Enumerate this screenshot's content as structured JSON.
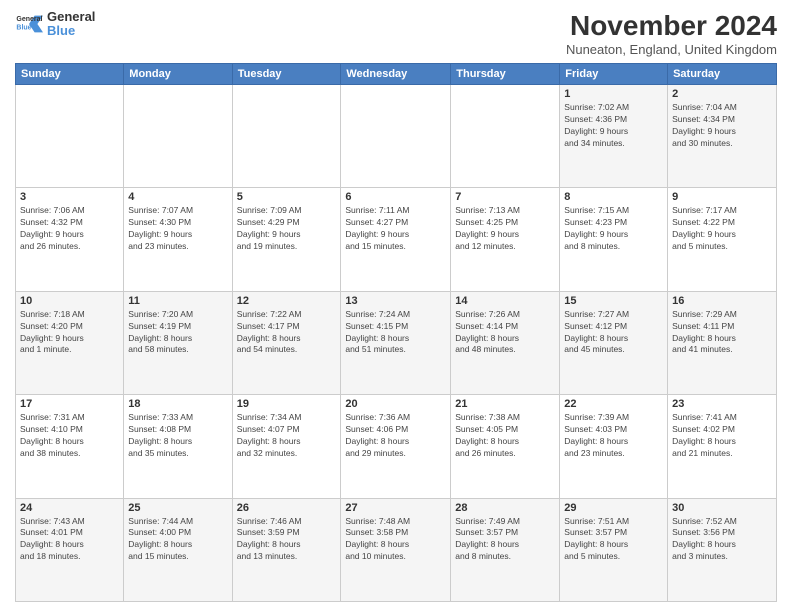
{
  "header": {
    "logo_general": "General",
    "logo_blue": "Blue",
    "month_year": "November 2024",
    "location": "Nuneaton, England, United Kingdom"
  },
  "weekdays": [
    "Sunday",
    "Monday",
    "Tuesday",
    "Wednesday",
    "Thursday",
    "Friday",
    "Saturday"
  ],
  "weeks": [
    [
      {
        "day": "",
        "info": ""
      },
      {
        "day": "",
        "info": ""
      },
      {
        "day": "",
        "info": ""
      },
      {
        "day": "",
        "info": ""
      },
      {
        "day": "",
        "info": ""
      },
      {
        "day": "1",
        "info": "Sunrise: 7:02 AM\nSunset: 4:36 PM\nDaylight: 9 hours\nand 34 minutes."
      },
      {
        "day": "2",
        "info": "Sunrise: 7:04 AM\nSunset: 4:34 PM\nDaylight: 9 hours\nand 30 minutes."
      }
    ],
    [
      {
        "day": "3",
        "info": "Sunrise: 7:06 AM\nSunset: 4:32 PM\nDaylight: 9 hours\nand 26 minutes."
      },
      {
        "day": "4",
        "info": "Sunrise: 7:07 AM\nSunset: 4:30 PM\nDaylight: 9 hours\nand 23 minutes."
      },
      {
        "day": "5",
        "info": "Sunrise: 7:09 AM\nSunset: 4:29 PM\nDaylight: 9 hours\nand 19 minutes."
      },
      {
        "day": "6",
        "info": "Sunrise: 7:11 AM\nSunset: 4:27 PM\nDaylight: 9 hours\nand 15 minutes."
      },
      {
        "day": "7",
        "info": "Sunrise: 7:13 AM\nSunset: 4:25 PM\nDaylight: 9 hours\nand 12 minutes."
      },
      {
        "day": "8",
        "info": "Sunrise: 7:15 AM\nSunset: 4:23 PM\nDaylight: 9 hours\nand 8 minutes."
      },
      {
        "day": "9",
        "info": "Sunrise: 7:17 AM\nSunset: 4:22 PM\nDaylight: 9 hours\nand 5 minutes."
      }
    ],
    [
      {
        "day": "10",
        "info": "Sunrise: 7:18 AM\nSunset: 4:20 PM\nDaylight: 9 hours\nand 1 minute."
      },
      {
        "day": "11",
        "info": "Sunrise: 7:20 AM\nSunset: 4:19 PM\nDaylight: 8 hours\nand 58 minutes."
      },
      {
        "day": "12",
        "info": "Sunrise: 7:22 AM\nSunset: 4:17 PM\nDaylight: 8 hours\nand 54 minutes."
      },
      {
        "day": "13",
        "info": "Sunrise: 7:24 AM\nSunset: 4:15 PM\nDaylight: 8 hours\nand 51 minutes."
      },
      {
        "day": "14",
        "info": "Sunrise: 7:26 AM\nSunset: 4:14 PM\nDaylight: 8 hours\nand 48 minutes."
      },
      {
        "day": "15",
        "info": "Sunrise: 7:27 AM\nSunset: 4:12 PM\nDaylight: 8 hours\nand 45 minutes."
      },
      {
        "day": "16",
        "info": "Sunrise: 7:29 AM\nSunset: 4:11 PM\nDaylight: 8 hours\nand 41 minutes."
      }
    ],
    [
      {
        "day": "17",
        "info": "Sunrise: 7:31 AM\nSunset: 4:10 PM\nDaylight: 8 hours\nand 38 minutes."
      },
      {
        "day": "18",
        "info": "Sunrise: 7:33 AM\nSunset: 4:08 PM\nDaylight: 8 hours\nand 35 minutes."
      },
      {
        "day": "19",
        "info": "Sunrise: 7:34 AM\nSunset: 4:07 PM\nDaylight: 8 hours\nand 32 minutes."
      },
      {
        "day": "20",
        "info": "Sunrise: 7:36 AM\nSunset: 4:06 PM\nDaylight: 8 hours\nand 29 minutes."
      },
      {
        "day": "21",
        "info": "Sunrise: 7:38 AM\nSunset: 4:05 PM\nDaylight: 8 hours\nand 26 minutes."
      },
      {
        "day": "22",
        "info": "Sunrise: 7:39 AM\nSunset: 4:03 PM\nDaylight: 8 hours\nand 23 minutes."
      },
      {
        "day": "23",
        "info": "Sunrise: 7:41 AM\nSunset: 4:02 PM\nDaylight: 8 hours\nand 21 minutes."
      }
    ],
    [
      {
        "day": "24",
        "info": "Sunrise: 7:43 AM\nSunset: 4:01 PM\nDaylight: 8 hours\nand 18 minutes."
      },
      {
        "day": "25",
        "info": "Sunrise: 7:44 AM\nSunset: 4:00 PM\nDaylight: 8 hours\nand 15 minutes."
      },
      {
        "day": "26",
        "info": "Sunrise: 7:46 AM\nSunset: 3:59 PM\nDaylight: 8 hours\nand 13 minutes."
      },
      {
        "day": "27",
        "info": "Sunrise: 7:48 AM\nSunset: 3:58 PM\nDaylight: 8 hours\nand 10 minutes."
      },
      {
        "day": "28",
        "info": "Sunrise: 7:49 AM\nSunset: 3:57 PM\nDaylight: 8 hours\nand 8 minutes."
      },
      {
        "day": "29",
        "info": "Sunrise: 7:51 AM\nSunset: 3:57 PM\nDaylight: 8 hours\nand 5 minutes."
      },
      {
        "day": "30",
        "info": "Sunrise: 7:52 AM\nSunset: 3:56 PM\nDaylight: 8 hours\nand 3 minutes."
      }
    ]
  ]
}
